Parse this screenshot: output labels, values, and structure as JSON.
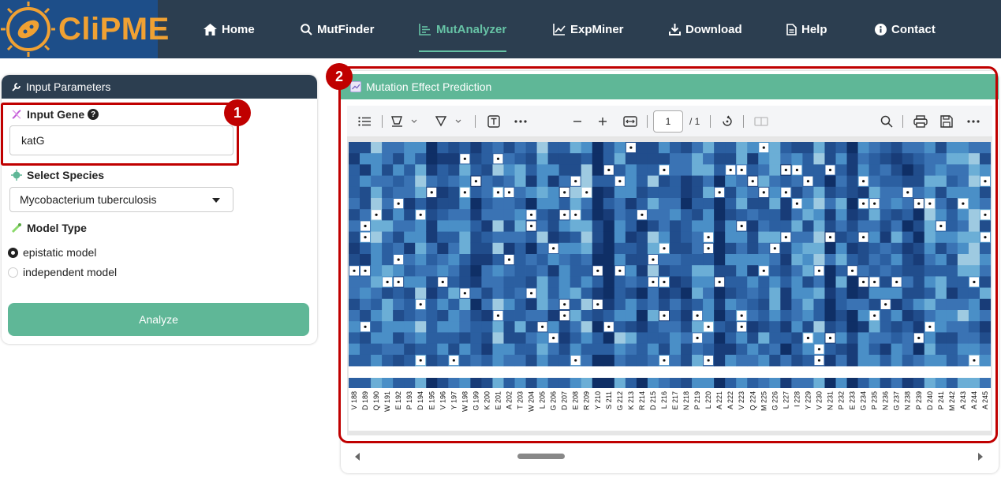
{
  "brand": {
    "name": "CliPME"
  },
  "nav": {
    "items": [
      {
        "label": "Home",
        "icon": "home-icon"
      },
      {
        "label": "MutFinder",
        "icon": "search-icon"
      },
      {
        "label": "MutAnalyzer",
        "icon": "chart-icon",
        "active": true
      },
      {
        "label": "ExpMiner",
        "icon": "line-chart-icon"
      },
      {
        "label": "Download",
        "icon": "download-icon"
      },
      {
        "label": "Help",
        "icon": "document-icon"
      },
      {
        "label": "Contact",
        "icon": "info-icon"
      }
    ]
  },
  "input_panel": {
    "title": "Input Parameters",
    "gene_label": "Input Gene",
    "gene_value": "katG",
    "species_label": "Select Species",
    "species_value": "Mycobacterium tuberculosis",
    "model_label": "Model Type",
    "models": [
      {
        "label": "epistatic model",
        "selected": true
      },
      {
        "label": "independent model",
        "selected": false
      }
    ],
    "analyze_label": "Analyze"
  },
  "result_panel": {
    "title": "Mutation Effect Prediction",
    "page_current": "1",
    "page_total": "/ 1"
  },
  "annotations": {
    "badge1": "1",
    "badge2": "2"
  },
  "colors": {
    "nav_bg": "#2c3e50",
    "accent": "#5fb797",
    "highlight": "#c00000",
    "brand": "#f0a133"
  },
  "chart_data": {
    "type": "heatmap",
    "columns": [
      "V 188",
      "D 189",
      "Q 190",
      "W 191",
      "E 192",
      "P 193",
      "D 194",
      "E 195",
      "V 196",
      "Y 197",
      "W 198",
      "G 199",
      "K 200",
      "E 201",
      "A 202",
      "T 203",
      "W 204",
      "L 205",
      "G 206",
      "D 207",
      "E 208",
      "R 209",
      "Y 210",
      "S 211",
      "G 212",
      "K 213",
      "R 214",
      "D 215",
      "L 216",
      "E 217",
      "N 218",
      "P 219",
      "L 220",
      "A 221",
      "A 222",
      "V 223",
      "Q 224",
      "M 225",
      "G 226",
      "L 227",
      "I 228",
      "Y 229",
      "V 230",
      "N 231",
      "P 232",
      "E 233",
      "G 234",
      "P 235",
      "N 236",
      "G 237",
      "N 238",
      "P 239",
      "D 240",
      "P 241",
      "M 242",
      "A 243",
      "A 244",
      "A 245"
    ],
    "rows": 20,
    "colorscale": [
      "#ffffff",
      "#08306b"
    ]
  }
}
